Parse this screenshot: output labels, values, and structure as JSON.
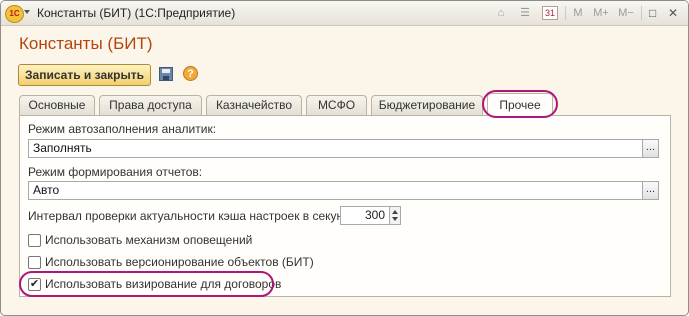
{
  "window": {
    "title": "Константы (БИТ)  (1С:Предприятие)",
    "logo_text": "1С",
    "toolbar_icons": [
      {
        "icon": "home-icon",
        "glyph": "⌂"
      },
      {
        "icon": "list-icon",
        "glyph": "☰"
      },
      {
        "icon": "calendar-icon",
        "glyph": "31"
      },
      {
        "icon": "memory-m-icon",
        "glyph": "M"
      },
      {
        "icon": "memory-plus-icon",
        "glyph": "M+"
      },
      {
        "icon": "memory-minus-icon",
        "glyph": "M−"
      }
    ],
    "restore_glyph": "□",
    "close_glyph": "✕"
  },
  "form": {
    "title": "Константы (БИТ)",
    "save_close_label": "Записать и закрыть",
    "help_glyph": "?"
  },
  "tabs": [
    {
      "label": "Основные",
      "active": false
    },
    {
      "label": "Права доступа",
      "active": false
    },
    {
      "label": "Казначейство",
      "active": false
    },
    {
      "label": "МСФО",
      "active": false
    },
    {
      "label": "Бюджетирование",
      "active": false
    },
    {
      "label": "Прочее",
      "active": true
    }
  ],
  "fields": {
    "autofill_label": "Режим автозаполнения аналитик:",
    "autofill_value": "Заполнять",
    "report_mode_label": "Режим формирования отчетов:",
    "report_mode_value": "Авто",
    "cache_interval_label": "Интервал проверки актуальности кэша настроек в секундах:",
    "cache_interval_value": "300",
    "ellipsis": "..."
  },
  "checkboxes": [
    {
      "label": "Использовать механизм оповещений",
      "checked": false
    },
    {
      "label": "Использовать версионирование объектов (БИТ)",
      "checked": false
    },
    {
      "label": "Использовать визирование для договоров",
      "checked": true
    }
  ],
  "colors": {
    "accent_title": "#b4450f",
    "highlight_ring": "#b0157a",
    "form_background": "#fbf5ea"
  }
}
